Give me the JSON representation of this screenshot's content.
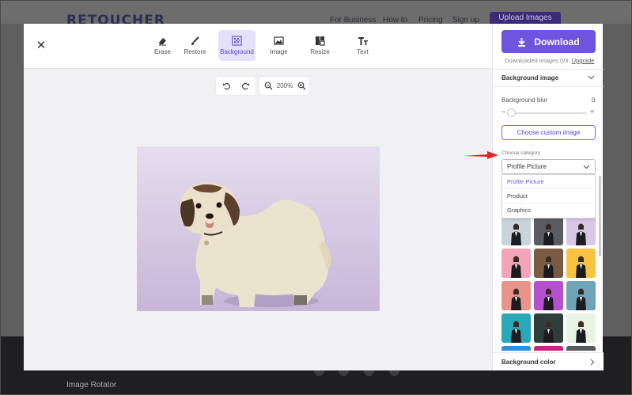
{
  "site": {
    "logo": "RETOUCHER",
    "nav": [
      "For Business",
      "How to",
      "Pricing",
      "Sign up"
    ],
    "upload_label": "Upload Images",
    "footer_link": "Image Rotator"
  },
  "toolbar": {
    "tools": [
      {
        "label": "Erase",
        "icon": "eraser-icon"
      },
      {
        "label": "Restore",
        "icon": "brush-icon"
      },
      {
        "label": "Background",
        "icon": "background-grid-icon",
        "active": true
      },
      {
        "label": "Image",
        "icon": "image-icon"
      },
      {
        "label": "Resize",
        "icon": "resize-icon"
      },
      {
        "label": "Text",
        "icon": "text-icon"
      }
    ]
  },
  "canvas": {
    "zoom": "200%"
  },
  "panel": {
    "download_label": "Download",
    "downloaded_note": "Downloaded images 0/3:",
    "upgrade_label": "Upgrade",
    "background_image_title": "Background image",
    "blur_label": "Background blur",
    "blur_value": "0",
    "custom_image_label": "Choose custom image",
    "category_label": "Choose category:",
    "category_selected": "Profile Picture",
    "category_options": [
      "Profile Picture",
      "Product",
      "Graphics"
    ],
    "background_color_title": "Background color"
  },
  "thumbnails": [
    "#c9d4dc",
    "#5a5c63",
    "#d9c7e6",
    "#f2a5b8",
    "#7a5a45",
    "#f7c442",
    "#e8948a",
    "#b44fcf",
    "#6fa3b8",
    "#2aa8b8",
    "#2f3e3c",
    "#e9f3e4",
    "#2f8fd9",
    "#c8227f",
    "#585a60"
  ]
}
